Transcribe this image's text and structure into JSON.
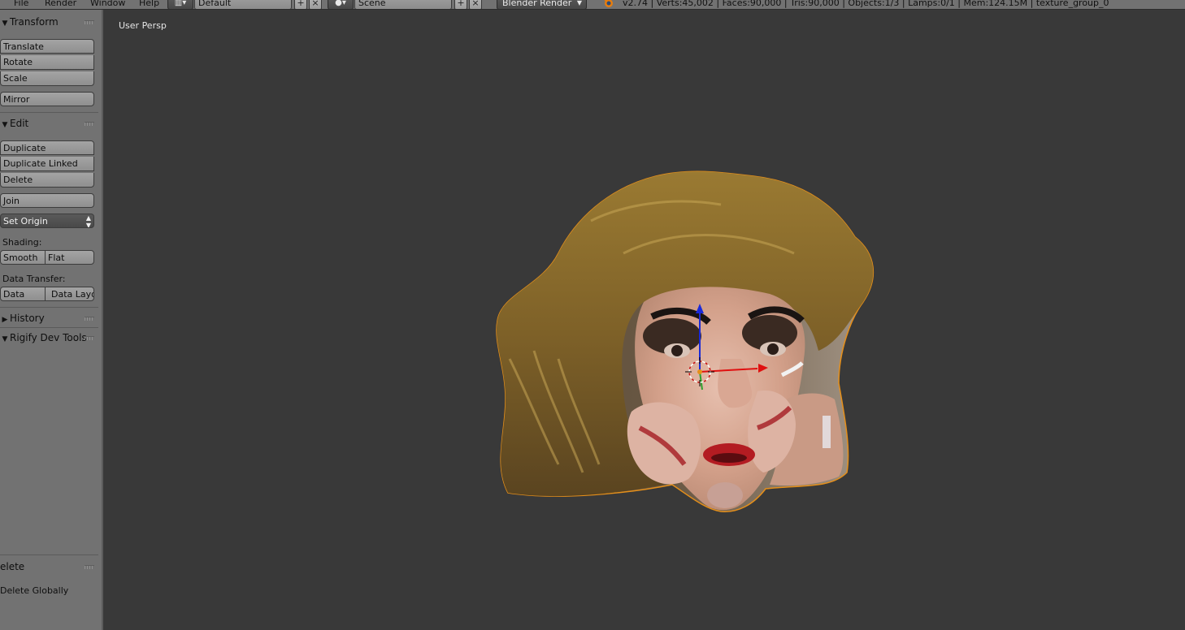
{
  "header": {
    "menus": [
      "File",
      "Render",
      "Window",
      "Help"
    ],
    "screen_layout": "Default",
    "scene": "Scene",
    "render_engine": "Blender Render",
    "stats": "v2.74 | Verts:45,002 | Faces:90,000 | Tris:90,000 | Objects:1/3 | Lamps:0/1 | Mem:124.15M | texture_group_0"
  },
  "toolshelf": {
    "transform": {
      "title": "Transform",
      "translate": "Translate",
      "rotate": "Rotate",
      "scale": "Scale",
      "mirror": "Mirror"
    },
    "edit": {
      "title": "Edit",
      "duplicate": "Duplicate",
      "duplicate_linked": "Duplicate Linked",
      "delete": "Delete",
      "join": "Join",
      "set_origin": "Set Origin",
      "shading_label": "Shading:",
      "smooth": "Smooth",
      "flat": "Flat",
      "data_transfer_label": "Data Transfer:",
      "data": "Data",
      "data_layout": "Data Layo"
    },
    "history": {
      "title": "History"
    },
    "rigify": {
      "title": "Rigify Dev Tools"
    },
    "operator": {
      "title": "elete",
      "option": "Delete Globally"
    }
  },
  "viewport": {
    "view_label": "User Persp"
  },
  "colors": {
    "background": "#393939",
    "panel": "#727272",
    "selection_outline": "#e58f1a",
    "axis_x": "#e01010",
    "axis_z": "#1a2ad8"
  },
  "icons": [
    "screen-layout-icon",
    "scene-icon",
    "add-icon",
    "close-icon",
    "blender-logo-icon",
    "triangle-icon",
    "grip-icon"
  ]
}
